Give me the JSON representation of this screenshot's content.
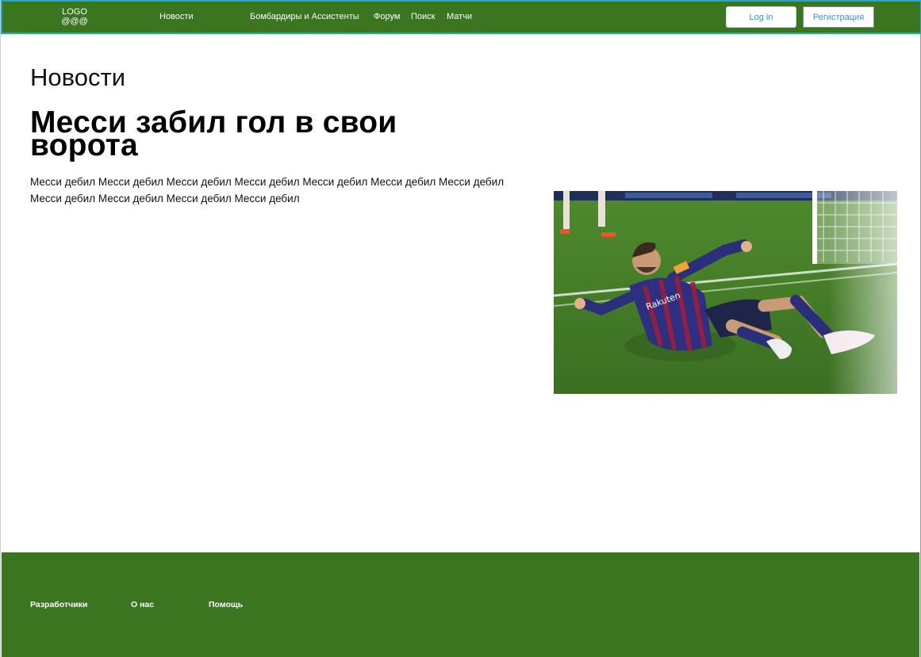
{
  "header": {
    "logo_line1": "LOGO",
    "logo_line2": "@@@",
    "nav": {
      "news": "Новости",
      "scorers": "Бомбардиры и Ассистенты",
      "forum": "Форум",
      "search": "Поиск",
      "matches": "Матчи"
    },
    "login_label": "Log in",
    "register_label": "Регистрация"
  },
  "main": {
    "section_title": "Новости",
    "article": {
      "title": "Месси забил гол в свои ворота",
      "body": "Месси дебил Месси дебил Месси дебил Месси дебил Месси дебил Месси дебил Месси дебил Месси дебил Месси дебил Месси дебил Месси дебил"
    }
  },
  "footer": {
    "developers": "Разработчики",
    "about": "О нас",
    "help": "Помощь"
  },
  "colors": {
    "brand_green": "#3a7520",
    "accent_blue": "#2f9bd0"
  }
}
